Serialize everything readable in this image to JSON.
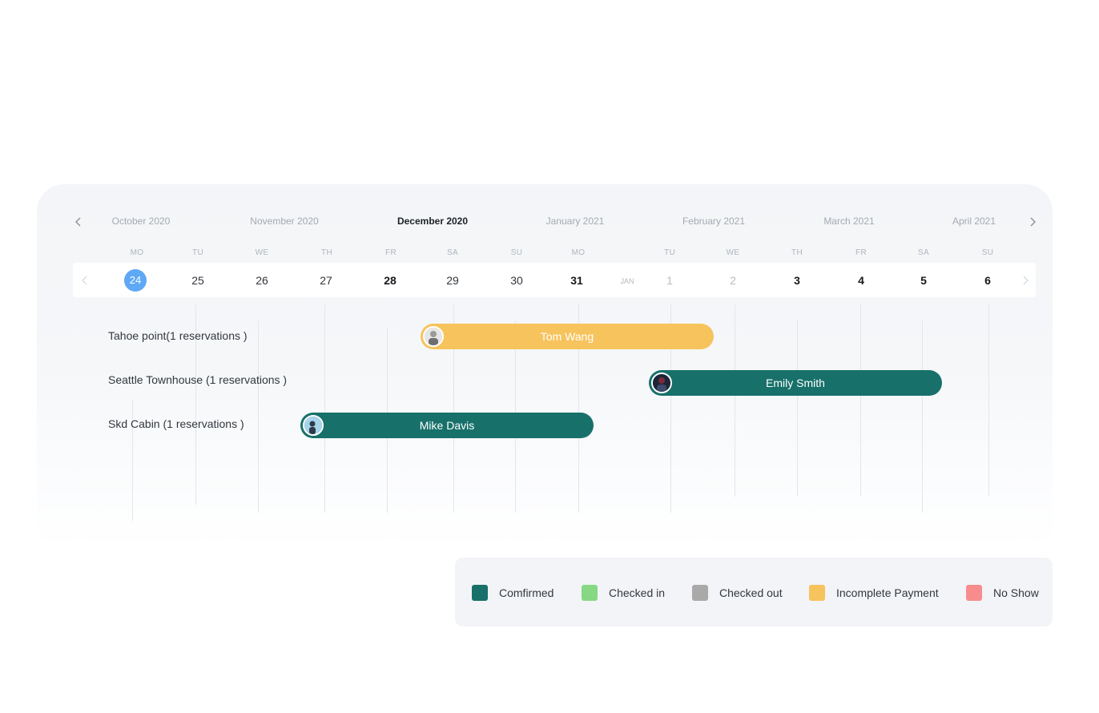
{
  "timeline": {
    "months": [
      {
        "label": "October 2020",
        "active": false
      },
      {
        "label": "November 2020",
        "active": false
      },
      {
        "label": "December 2020",
        "active": true
      },
      {
        "label": "January 2021",
        "active": false
      },
      {
        "label": "February 2021",
        "active": false
      },
      {
        "label": "March 2021",
        "active": false
      },
      {
        "label": "April 2021",
        "active": false
      }
    ],
    "weekdays": [
      "MO",
      "TU",
      "WE",
      "TH",
      "FR",
      "SA",
      "SU",
      "MO",
      "TU",
      "WE",
      "TH",
      "FR",
      "SA",
      "SU"
    ],
    "days": [
      {
        "label": "24",
        "style": "today"
      },
      {
        "label": "25",
        "style": "normal"
      },
      {
        "label": "26",
        "style": "normal"
      },
      {
        "label": "27",
        "style": "normal"
      },
      {
        "label": "28",
        "style": "bold"
      },
      {
        "label": "29",
        "style": "normal"
      },
      {
        "label": "30",
        "style": "normal"
      },
      {
        "label": "31",
        "style": "bold"
      },
      {
        "label": "1",
        "style": "muted"
      },
      {
        "label": "2",
        "style": "muted"
      },
      {
        "label": "3",
        "style": "bold"
      },
      {
        "label": "4",
        "style": "bold"
      },
      {
        "label": "5",
        "style": "bold"
      },
      {
        "label": "6",
        "style": "bold"
      }
    ],
    "month_marker": "JAN"
  },
  "properties": [
    {
      "label": "Tahoe point(1 reservations )"
    },
    {
      "label": "Seattle Townhouse (1 reservations )"
    },
    {
      "label": "Skd Cabin (1 reservations )"
    }
  ],
  "reservations": [
    {
      "guest": "Tom Wang",
      "status": "Incomplete Payment",
      "color": "#f7c35c",
      "avatar": "#e8e8e8"
    },
    {
      "guest": "Emily Smith",
      "status": "Comfirmed",
      "color": "#17716a",
      "avatar": "#2b3a55"
    },
    {
      "guest": "Mike Davis",
      "status": "Comfirmed",
      "color": "#17716a",
      "avatar": "#8fc3e0"
    }
  ],
  "legend": [
    {
      "label": "Comfirmed",
      "color": "#17716a"
    },
    {
      "label": "Checked in",
      "color": "#86d883"
    },
    {
      "label": "Checked out",
      "color": "#a9a9a9"
    },
    {
      "label": "Incomplete Payment",
      "color": "#f7c35c"
    },
    {
      "label": "No Show",
      "color": "#f88c8c"
    }
  ]
}
